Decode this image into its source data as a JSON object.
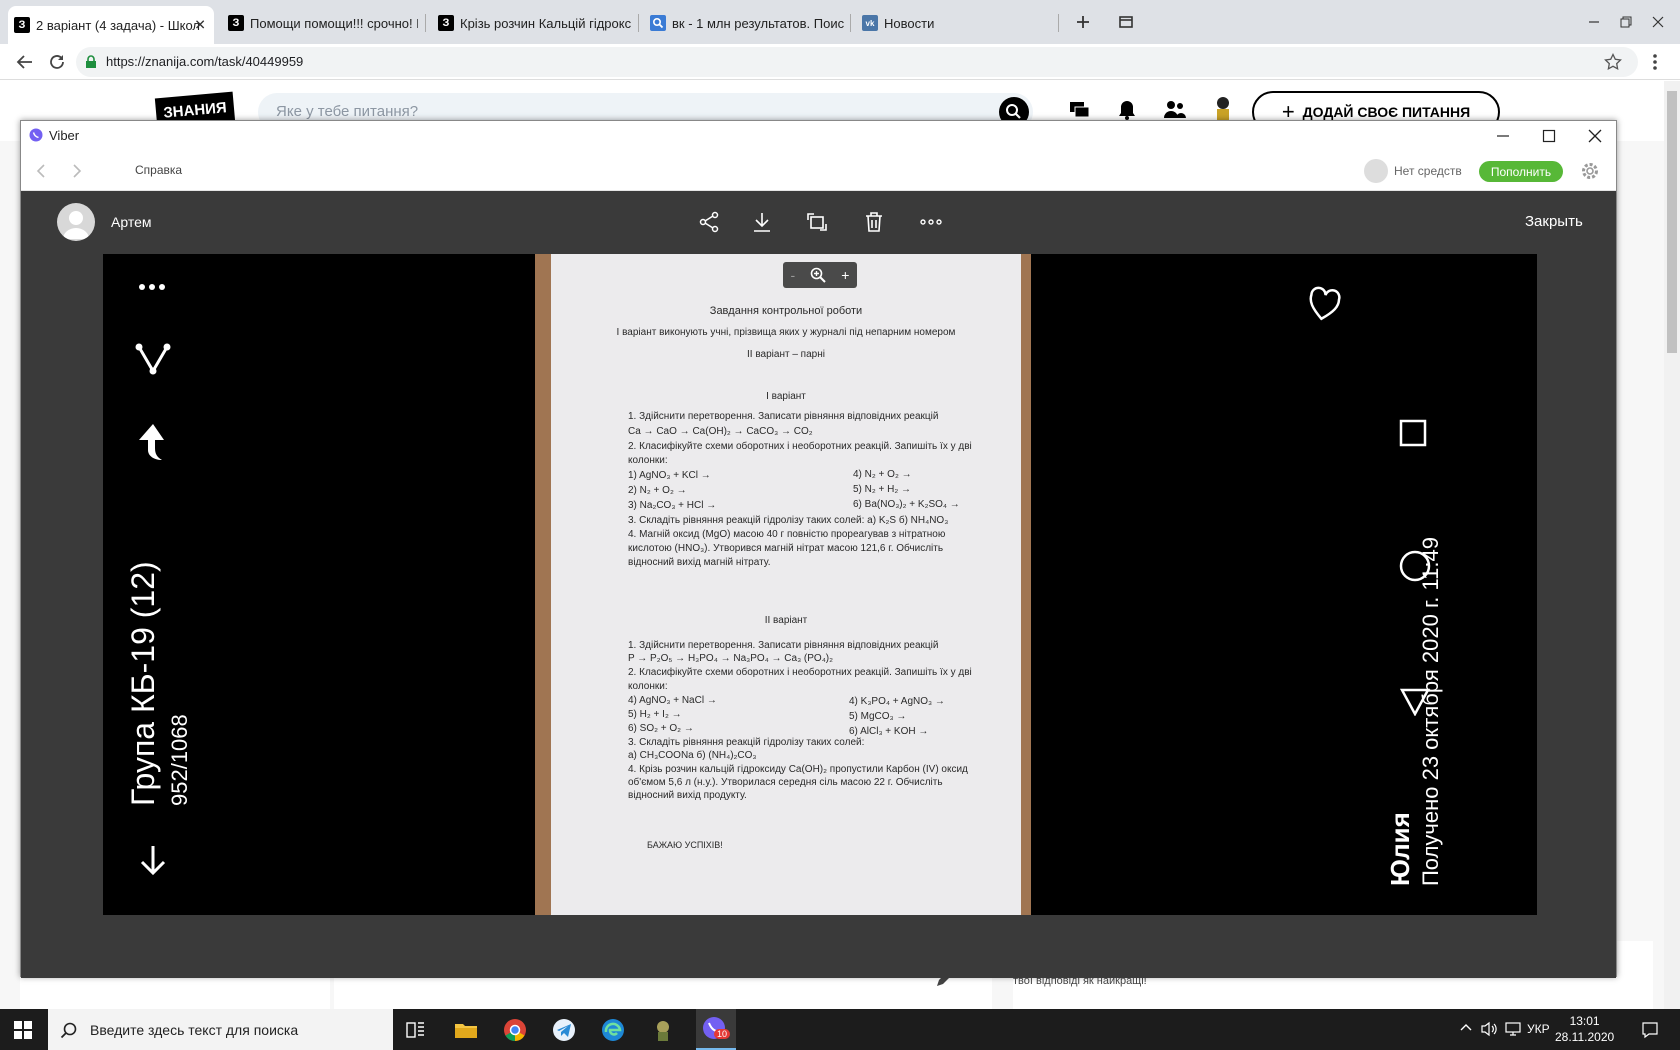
{
  "browser": {
    "tabs": [
      {
        "label": "2 варіант (4 задача) - Школ",
        "favicon": "З",
        "active": true
      },
      {
        "label": "Помощи помощи!!! срочно! По",
        "favicon": "З",
        "active": false
      },
      {
        "label": "Крізь розчин Кальцій гідрокси",
        "favicon": "З",
        "active": false
      },
      {
        "label": "вк - 1 млн результатов. Поиск",
        "favicon": "search",
        "active": false
      },
      {
        "label": "Новости",
        "favicon": "vk",
        "active": false
      }
    ],
    "url": "https://znanija.com/task/40449959"
  },
  "znanija": {
    "logo_text": "ЗНАНИЯ",
    "search_placeholder": "Яке у тебе питання?",
    "ask_button": "ДОДАЙ СВОЄ ПИТАННЯ",
    "bottom_text": "твої відповіді як найкращі!"
  },
  "viber": {
    "window_title": "Viber",
    "help_menu": "Справка",
    "no_funds": "Нет средств",
    "topup_button": "Пополнить",
    "sender_name": "Артем",
    "close_label": "Закрыть",
    "zoom_minus": "-",
    "zoom_plus": "+"
  },
  "photo": {
    "left_overlay": {
      "group_title": "Група КБ-19 (12)",
      "counter": "952/1068"
    },
    "right_overlay": {
      "name": "Юлия",
      "received": "Получено 23 октября 2020 г. 11:49"
    },
    "document": {
      "title": "Завдання контрольної роботи",
      "line1": "І варіант виконують учні, прізвища яких у журналі під непарним номером",
      "line2": "ІІ варіант – парні",
      "v1_title": "І варіант",
      "v1_lines": [
        "1.  Здійснити перетворення.  Записати рівняння відповідних реакцій",
        "       Ca → CaO → Ca(OH)₂ → CaCO₃ → CO₂",
        "2.  Класифікуйте схеми оборотних і необоротних реакцій.  Запишіть їх у дві",
        "     колонки:",
        "     1)  AgNO₃ + KCl →",
        "     2)  N₂ + O₂ →",
        "     3)  Na₂CO₃ + HCl →",
        "3.  Складіть рівняння реакцій гідролізу таких солей:  а)  K₂S       б)  NH₄NO₃",
        "4.  Магній оксид (MgO) масою 40 г повністю прореагував з нітратною",
        "     кислотою (HNO₃).  Утворився магній нітрат масою 121,6 г.  Обчисліть",
        "     відносний вихід магній нітрату."
      ],
      "v1_right": [
        "4)  N₂ + O₂ →",
        "5)  N₂ + H₂ →",
        "6) Ba(NO₃)₂ + K₂SO₄ →"
      ],
      "v2_title": "ІІ варіант",
      "v2_lines": [
        "1.  Здійснити перетворення.  Записати рівняння відповідних реакцій",
        "       P → P₂O₅ → H₃PO₄ → Na₃PO₄ → Ca₃ (PO₄)₂",
        "2.  Класифікуйте схеми оборотних і необоротних реакцій.  Запишіть їх у дві",
        "     колонки:",
        "     4)  AgNO₃ + NaCl →",
        "     5)  H₂ + I₂ →",
        "     6)  SO₂ + O₂ →",
        "3.  Складіть рівняння реакцій гідролізу таких солей:",
        "               а)  CH₃COONa       б) (NH₄)₂CO₃",
        "4.  Крізь розчин кальцій гідроксиду Ca(OH)₂ пропустили Карбон (IV) оксид",
        "     об'ємом 5,6 л (н.у.). Утворилася середня сіль масою 22 г. Обчисліть",
        "     відносний вихід продукту."
      ],
      "v2_right": [
        "4)  K₃PO₄ + AgNO₃ →",
        "5)  MgCO₃ →",
        "6)  AlCl₃ + KOH →"
      ],
      "footer": "БАЖАЮ УСПІХІВ!"
    }
  },
  "taskbar": {
    "search_placeholder": "Введите здесь текст для поиска",
    "lang": "УКР",
    "time": "13:01",
    "date": "28.11.2020",
    "viber_badge": "10"
  }
}
